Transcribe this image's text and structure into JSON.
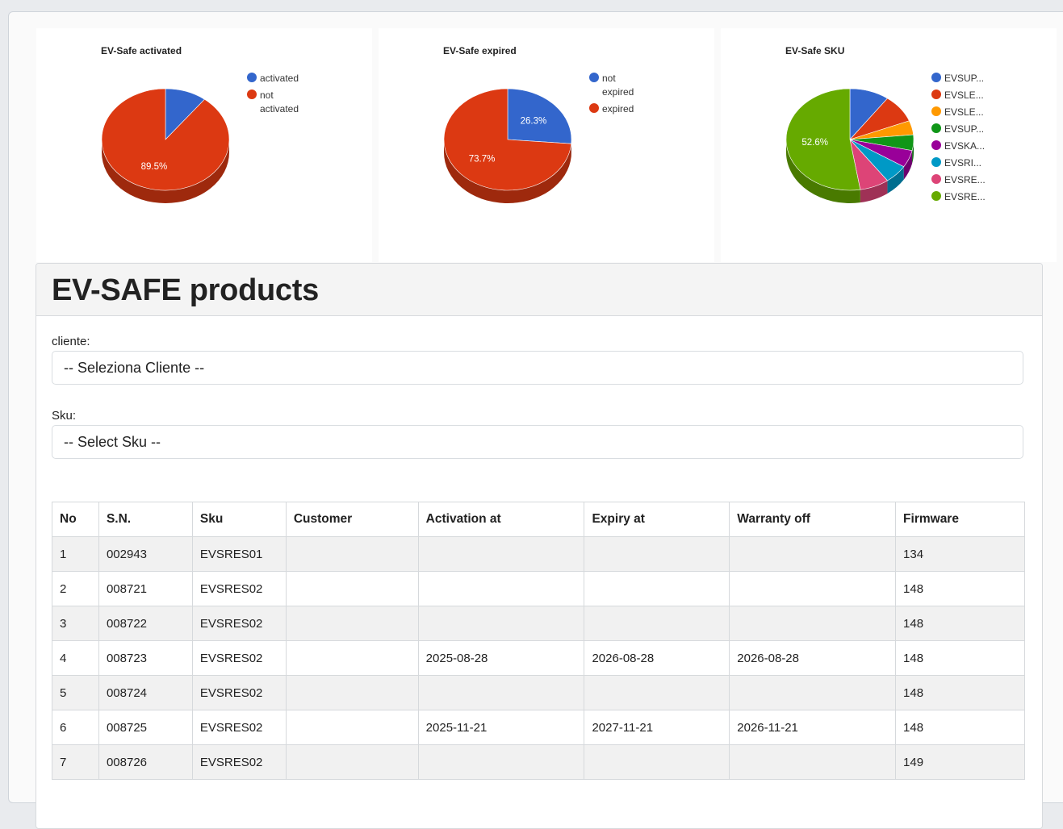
{
  "charts": [
    {
      "title": "EV-Safe activated",
      "slices": [
        {
          "label": "activated",
          "value": 10.5,
          "color": "#3366cc",
          "text": ""
        },
        {
          "label": "not activated",
          "value": 89.5,
          "color": "#dc3912",
          "text": "89.5%"
        }
      ],
      "legend": [
        {
          "lines": [
            "activated"
          ],
          "color": "#3366cc"
        },
        {
          "lines": [
            "not",
            "activated"
          ],
          "color": "#dc3912"
        }
      ]
    },
    {
      "title": "EV-Safe expired",
      "slices": [
        {
          "label": "not expired",
          "value": 26.3,
          "color": "#3366cc",
          "text": "26.3%"
        },
        {
          "label": "expired",
          "value": 73.7,
          "color": "#dc3912",
          "text": "73.7%"
        }
      ],
      "legend": [
        {
          "lines": [
            "not",
            "expired"
          ],
          "color": "#3366cc"
        },
        {
          "lines": [
            "expired"
          ],
          "color": "#dc3912"
        }
      ]
    },
    {
      "title": "EV-Safe SKU",
      "slices": [
        {
          "label": "EVSUP...",
          "value": 10.0,
          "color": "#3366cc",
          "text": ""
        },
        {
          "label": "EVSLE...",
          "value": 9.0,
          "color": "#dc3912",
          "text": ""
        },
        {
          "label": "EVSLE...",
          "value": 4.5,
          "color": "#ff9900",
          "text": ""
        },
        {
          "label": "EVSUP...",
          "value": 5.0,
          "color": "#109618",
          "text": ""
        },
        {
          "label": "EVSKA...",
          "value": 5.5,
          "color": "#990099",
          "text": ""
        },
        {
          "label": "EVSRI...",
          "value": 6.0,
          "color": "#0099c6",
          "text": ""
        },
        {
          "label": "EVSRE...",
          "value": 7.4,
          "color": "#dd4477",
          "text": ""
        },
        {
          "label": "EVSRE...",
          "value": 52.6,
          "color": "#66aa00",
          "text": "52.6%"
        }
      ],
      "legend": [
        {
          "lines": [
            "EVSUP..."
          ],
          "color": "#3366cc"
        },
        {
          "lines": [
            "EVSLE..."
          ],
          "color": "#dc3912"
        },
        {
          "lines": [
            "EVSLE..."
          ],
          "color": "#ff9900"
        },
        {
          "lines": [
            "EVSUP..."
          ],
          "color": "#109618"
        },
        {
          "lines": [
            "EVSKA..."
          ],
          "color": "#990099"
        },
        {
          "lines": [
            "EVSRI..."
          ],
          "color": "#0099c6"
        },
        {
          "lines": [
            "EVSRE..."
          ],
          "color": "#dd4477"
        },
        {
          "lines": [
            "EVSRE..."
          ],
          "color": "#66aa00"
        }
      ]
    }
  ],
  "panel": {
    "title": "EV-SAFE products",
    "cliente_label": "cliente:",
    "cliente_value": "-- Seleziona Cliente --",
    "sku_label": "Sku:",
    "sku_value": "-- Select Sku --"
  },
  "table": {
    "headers": [
      "No",
      "S.N.",
      "Sku",
      "Customer",
      "Activation at",
      "Expiry at",
      "Warranty off",
      "Firmware"
    ],
    "rows": [
      [
        "1",
        "002943",
        "EVSRES01",
        "",
        "",
        "",
        "",
        "134"
      ],
      [
        "2",
        "008721",
        "EVSRES02",
        "",
        "",
        "",
        "",
        "148"
      ],
      [
        "3",
        "008722",
        "EVSRES02",
        "",
        "",
        "",
        "",
        "148"
      ],
      [
        "4",
        "008723",
        "EVSRES02",
        "",
        "2025-08-28",
        "2026-08-28",
        "2026-08-28",
        "148"
      ],
      [
        "5",
        "008724",
        "EVSRES02",
        "",
        "",
        "",
        "",
        "148"
      ],
      [
        "6",
        "008725",
        "EVSRES02",
        "",
        "2025-11-21",
        "2027-11-21",
        "2026-11-21",
        "148"
      ],
      [
        "7",
        "008726",
        "EVSRES02",
        "",
        "",
        "",
        "",
        "149"
      ]
    ]
  }
}
